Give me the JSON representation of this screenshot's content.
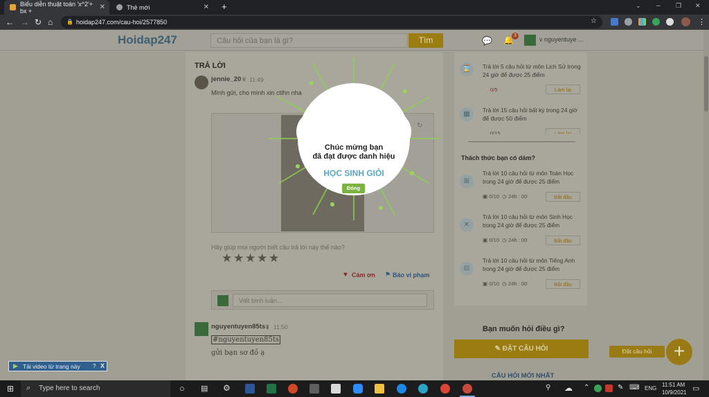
{
  "browser": {
    "tabs": [
      {
        "title": "Biểu diễn thuật toán 'x^2'+ bx +",
        "active": true
      },
      {
        "title": "Thẻ mới",
        "active": false
      }
    ],
    "new_tab": "+",
    "url": "hoidap247.com/cau-hoi/2577850",
    "window_controls": [
      "⌄",
      "–",
      "❐",
      "✕"
    ]
  },
  "site": {
    "logo": "Hoidap247",
    "search_placeholder": "Câu hỏi của bạn là gì?",
    "search_button": "Tìm",
    "notif_count": "3",
    "username": "v nguyentuye ..."
  },
  "answers": {
    "section_title": "TRẢ LỜI",
    "first": {
      "username": "jennie_20",
      "time": "11:49",
      "text": "Mình gửi, cho mình xin ctlhn nha"
    },
    "rate_prompt": "Hãy giúp mọi người biết câu trả lời này thế nào?",
    "thanks": "Cảm ơn",
    "report": "Báo vi phạm",
    "comment_placeholder": "Viết bình luận...",
    "second": {
      "username": "nguyentuyen85ts",
      "time": "11:50",
      "tag": "#nguyentuyen85ts",
      "text": "gửi bạn sơ đồ ạ"
    }
  },
  "sidebar": {
    "tasks_top": [
      {
        "text": "Trả lời 5 câu hỏi từ môn Lịch Sử trong 24 giờ để được 25 điểm",
        "progress": "0/5",
        "button": "Làm lại"
      },
      {
        "text": "Trả lời 15 câu hỏi bất kỳ trong 24 giờ để được 50 điểm",
        "progress": "0/15",
        "button": "Làm lại"
      }
    ],
    "challenge_title": "Thách thức bạn có dám?",
    "challenges": [
      {
        "text": "Trả lời 10 câu hỏi từ môn Toán Học trong 24 giờ để được 25 điểm",
        "progress": "0/10",
        "time": "24h : 00",
        "button": "Bắt đầu"
      },
      {
        "text": "Trả lời 10 câu hỏi từ môn Sinh Học trong 24 giờ để được 25 điểm",
        "progress": "0/10",
        "time": "24h : 00",
        "button": "Bắt đầu"
      },
      {
        "text": "Trả lời 10 câu hỏi từ môn Tiếng Anh trong 24 giờ để được 25 điểm",
        "progress": "0/10",
        "time": "24h : 00",
        "button": "Bắt đầu"
      }
    ],
    "ask_title": "Bạn muốn hỏi điều gì?",
    "ask_button": "ĐẶT CÂU HỎI",
    "newest_title": "CÂU HỎI MỚI NHẤT"
  },
  "popup": {
    "line1": "Chúc mừng bạn",
    "line2": "đã đạt được danh hiệu",
    "title": "HỌC SINH GIỎI",
    "close": "Đóng"
  },
  "fab": {
    "label": "Đặt câu hỏi",
    "icon": "+"
  },
  "download_bar": {
    "text": "Tải video từ trang này",
    "help": "?",
    "close": "X"
  },
  "taskbar": {
    "search_placeholder": "Type here to search",
    "lang": "ENG",
    "time": "11:51 AM",
    "date": "10/9/2021"
  },
  "colors": {
    "accent": "#9c7d12",
    "popup_title": "#5aa6c4",
    "close_btn": "#7cb342"
  }
}
